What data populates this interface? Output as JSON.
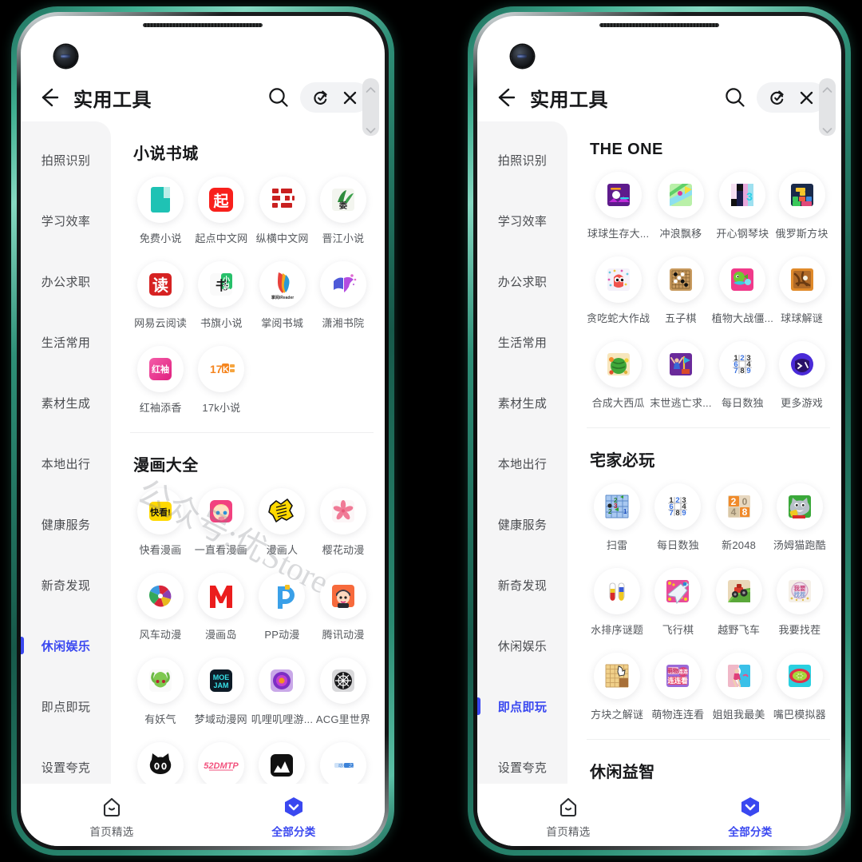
{
  "device": {
    "frame_color": "#2e8f77",
    "count": 2
  },
  "header": {
    "back_icon": "back-arrow-icon",
    "title": "实用工具",
    "search_icon": "search-icon",
    "refresh_icon": "refresh-check-icon",
    "close_icon": "close-icon"
  },
  "scrollbar": {
    "up_icon": "chevron-up-icon",
    "down_icon": "chevron-down-icon"
  },
  "sidebar": {
    "items": [
      {
        "label": "拍照识别"
      },
      {
        "label": "学习效率"
      },
      {
        "label": "办公求职"
      },
      {
        "label": "生活常用"
      },
      {
        "label": "素材生成"
      },
      {
        "label": "本地出行"
      },
      {
        "label": "健康服务"
      },
      {
        "label": "新奇发现"
      },
      {
        "label": "休闲娱乐"
      },
      {
        "label": "即点即玩"
      },
      {
        "label": "设置夸克"
      }
    ],
    "active_left": "休闲娱乐",
    "active_right": "即点即玩",
    "active_color": "#3a48f0"
  },
  "watermark": {
    "text": "公众号:优Store"
  },
  "tabbar": {
    "tabs": [
      {
        "label": "首页精选",
        "icon": "home-icon",
        "active": false
      },
      {
        "label": "全部分类",
        "icon": "hexagon-chevron-icon",
        "active": true
      }
    ],
    "active_color": "#3a48f0"
  },
  "left_phone": {
    "sections": [
      {
        "title": "小说书城",
        "apps": [
          {
            "label": "免费小说",
            "icon": "free-novel-book-icon"
          },
          {
            "label": "起点中文网",
            "icon": "qidian-icon"
          },
          {
            "label": "纵横中文网",
            "icon": "zongheng-icon"
          },
          {
            "label": "晋江小说",
            "icon": "jinjiang-icon"
          },
          {
            "label": "网易云阅读",
            "icon": "netease-read-icon"
          },
          {
            "label": "书旗小说",
            "icon": "shuqi-icon"
          },
          {
            "label": "掌阅书城",
            "icon": "ireader-icon"
          },
          {
            "label": "潇湘书院",
            "icon": "xiaoxiang-icon"
          },
          {
            "label": "红袖添香",
            "icon": "hongxiu-icon"
          },
          {
            "label": "17k小说",
            "icon": "17k-icon"
          }
        ]
      },
      {
        "title": "漫画大全",
        "apps": [
          {
            "label": "快看漫画",
            "icon": "kuaikan-icon"
          },
          {
            "label": "一直看漫画",
            "icon": "yizhikan-icon"
          },
          {
            "label": "漫画人",
            "icon": "manhuaren-icon"
          },
          {
            "label": "樱花动漫",
            "icon": "yinghua-sakura-icon"
          },
          {
            "label": "风车动漫",
            "icon": "fengche-pinwheel-icon"
          },
          {
            "label": "漫画岛",
            "icon": "manhuadao-m-icon"
          },
          {
            "label": "PP动漫",
            "icon": "pp-dongman-icon"
          },
          {
            "label": "腾讯动漫",
            "icon": "tencent-comic-icon"
          },
          {
            "label": "有妖气",
            "icon": "u17-youyaoqi-icon"
          },
          {
            "label": "梦域动漫网",
            "icon": "moejam-icon"
          },
          {
            "label": "叽哩叽哩游...",
            "icon": "girigiri-icon"
          },
          {
            "label": "ACG里世界",
            "icon": "acg-world-icon"
          },
          {
            "label": "",
            "icon": "black-cat-icon"
          },
          {
            "label": "",
            "icon": "52dmtp-icon"
          },
          {
            "label": "",
            "icon": "mountain-icon"
          },
          {
            "label": "",
            "icon": "blue-bar-icon"
          }
        ]
      }
    ]
  },
  "right_phone": {
    "sections": [
      {
        "title": "THE ONE",
        "apps": [
          {
            "label": "球球生存大...",
            "icon": "ball-survival-icon"
          },
          {
            "label": "冲浪飘移",
            "icon": "surf-drift-icon"
          },
          {
            "label": "开心钢琴块",
            "icon": "piano-tiles-icon"
          },
          {
            "label": "俄罗斯方块",
            "icon": "tetris-icon"
          },
          {
            "label": "贪吃蛇大作战",
            "icon": "snake-battle-icon"
          },
          {
            "label": "五子棋",
            "icon": "gomoku-icon"
          },
          {
            "label": "植物大战僵...",
            "icon": "pvz-icon"
          },
          {
            "label": "球球解谜",
            "icon": "ball-puzzle-icon"
          },
          {
            "label": "合成大西瓜",
            "icon": "watermelon-icon"
          },
          {
            "label": "末世逃亡求...",
            "icon": "escape-icon"
          },
          {
            "label": "每日数独",
            "icon": "sudoku-icon"
          },
          {
            "label": "更多游戏",
            "icon": "more-games-icon"
          }
        ]
      },
      {
        "title": "宅家必玩",
        "apps": [
          {
            "label": "扫雷",
            "icon": "minesweeper-icon"
          },
          {
            "label": "每日数独",
            "icon": "sudoku-icon"
          },
          {
            "label": "新2048",
            "icon": "2048-icon"
          },
          {
            "label": "汤姆猫跑酷",
            "icon": "talking-tom-icon"
          },
          {
            "label": "水排序谜题",
            "icon": "water-sort-icon"
          },
          {
            "label": "飞行棋",
            "icon": "ludo-plane-icon"
          },
          {
            "label": "越野飞车",
            "icon": "hill-climb-icon"
          },
          {
            "label": "我要找茬",
            "icon": "spot-difference-icon"
          },
          {
            "label": "方块之解谜",
            "icon": "block-puzzle-icon"
          },
          {
            "label": "萌物连连看",
            "icon": "link-game-icon"
          },
          {
            "label": "姐姐我最美",
            "icon": "beauty-run-icon"
          },
          {
            "label": "嘴巴模拟器",
            "icon": "mouth-sim-icon"
          }
        ]
      },
      {
        "title": "休闲益智",
        "apps": []
      }
    ]
  }
}
